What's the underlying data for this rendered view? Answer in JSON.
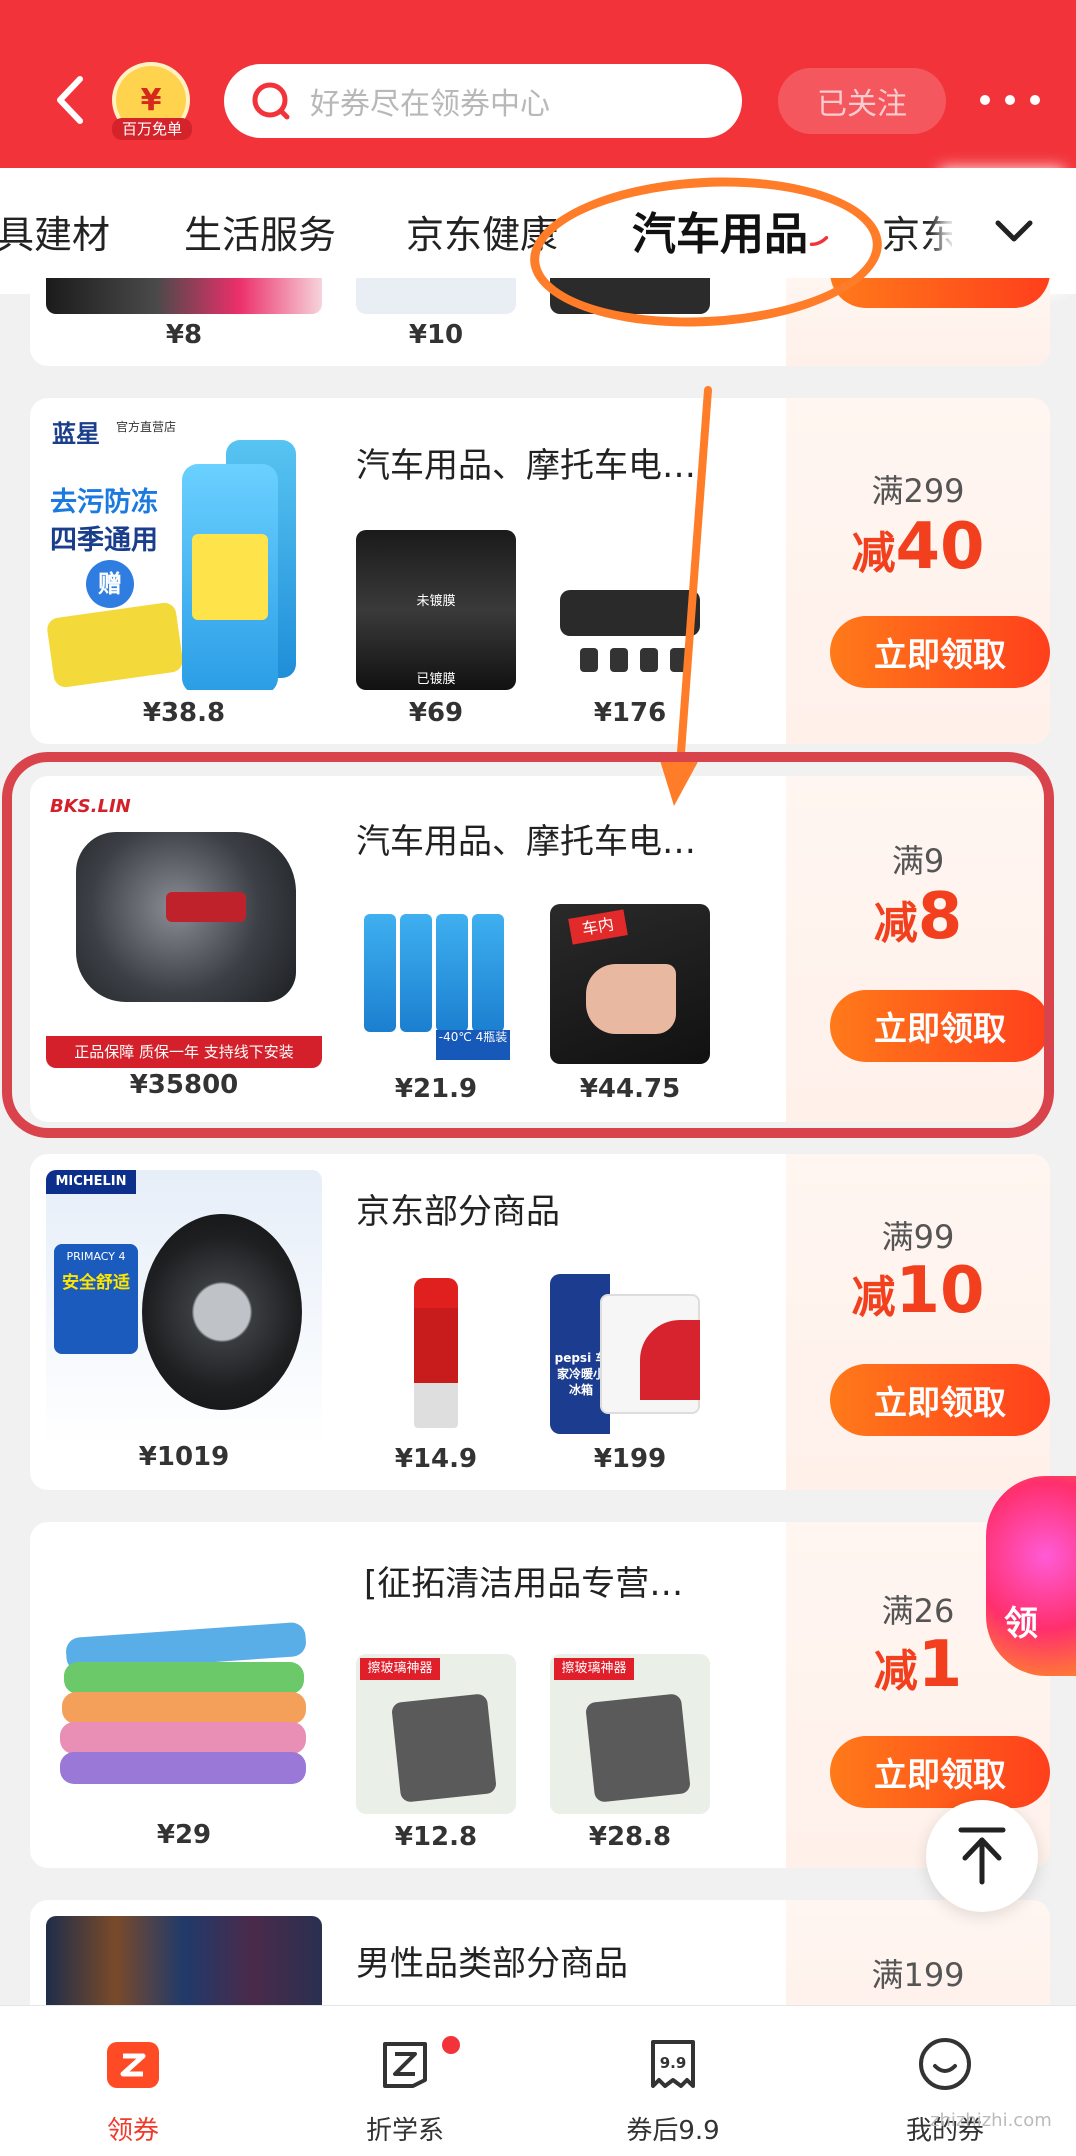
{
  "header": {
    "badge_label": "百万免单",
    "badge_symbol": "¥",
    "search_placeholder": "好券尽在领券中心",
    "follow_label": "已关注"
  },
  "tabs": [
    "具建材",
    "生活服务",
    "京东健康",
    "汽车用品",
    "京东"
  ],
  "active_tab": "汽车用品",
  "cards": [
    {
      "prices": [
        "¥8",
        "¥10"
      ]
    },
    {
      "title": "汽车用品、摩托车电…",
      "main_price": "¥38.8",
      "main_text": [
        "蓝星",
        "官方直营店",
        "去污防冻",
        "四季通用",
        "赠"
      ],
      "thumbs": [
        {
          "price": "¥69",
          "caption_top": "未镀膜",
          "caption_bottom": "已镀膜"
        },
        {
          "price": "¥176"
        }
      ],
      "coupon": {
        "condition": "满299",
        "prefix": "减",
        "amount": "40",
        "button": "立即领取"
      }
    },
    {
      "title": "汽车用品、摩托车电…",
      "main_price": "¥35800",
      "main_text": [
        "BKS.LIN",
        "正品保障  质保一年  支持线下安装"
      ],
      "thumbs": [
        {
          "price": "¥21.9",
          "caption": "-40℃ 4瓶装"
        },
        {
          "price": "¥44.75",
          "caption": "车内"
        }
      ],
      "coupon": {
        "condition": "满9",
        "prefix": "减",
        "amount": "8",
        "button": "立即领取"
      }
    },
    {
      "title": "京东部分商品",
      "main_price": "¥1019",
      "main_text": [
        "MICHELIN",
        "PRIMACY 4",
        "安全舒适"
      ],
      "thumbs": [
        {
          "price": "¥14.9"
        },
        {
          "price": "¥199",
          "caption": "pepsi 车家冷暖小冰箱"
        }
      ],
      "coupon": {
        "condition": "满99",
        "prefix": "减",
        "amount": "10",
        "button": "立即领取"
      }
    },
    {
      "title": "[征拓清洁用品专营…",
      "main_price": "¥29",
      "thumbs": [
        {
          "price": "¥12.8",
          "caption": "擦玻璃神器"
        },
        {
          "price": "¥28.8",
          "caption": "擦玻璃神器"
        }
      ],
      "coupon": {
        "condition": "满26",
        "prefix": "减",
        "amount": "1",
        "button": "立即领取"
      }
    },
    {
      "title": "男性品类部分商品",
      "coupon": {
        "condition": "满199"
      }
    }
  ],
  "float_promo": "领",
  "bottom_nav": [
    {
      "label": "领券",
      "icon": "coupon-icon"
    },
    {
      "label": "折学系",
      "icon": "z-icon"
    },
    {
      "label": "券后9.9",
      "icon": "ticket-icon",
      "icon_text": "9.9"
    },
    {
      "label": "我的券",
      "icon": "smile-icon"
    }
  ],
  "watermark": "zhizhizhi.com",
  "colors": {
    "brand": "#f2333a",
    "button": "#ff4e1c",
    "accent": "#ff7c28",
    "highlight": "#d9434c"
  }
}
